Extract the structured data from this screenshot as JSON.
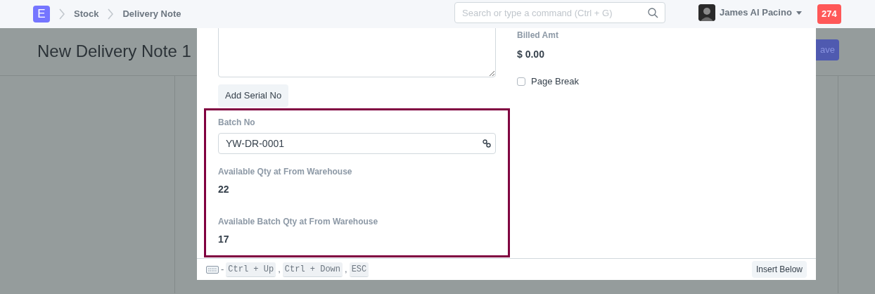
{
  "navbar": {
    "logo": "E",
    "breadcrumbs": [
      "Stock",
      "Delivery Note"
    ],
    "search": {
      "placeholder": "Search or type a command (Ctrl + G)"
    },
    "user": {
      "name": "James Al Pacino"
    },
    "notifications": "274"
  },
  "page": {
    "title": "New Delivery Note 1",
    "save_button": "ave"
  },
  "dialog": {
    "add_serial_button": "Add Serial No",
    "batch": {
      "label": "Batch No",
      "value": "YW-DR-0001"
    },
    "fields": [
      {
        "label": "Available Qty at From Warehouse",
        "value": "22"
      },
      {
        "label": "Available Batch Qty at From Warehouse",
        "value": "17"
      }
    ],
    "billed": {
      "label": "Billed Amt",
      "value": "$ 0.00"
    },
    "page_break": {
      "label": "Page Break",
      "checked": false
    },
    "shortcut_dash": "-",
    "shortcut_separator": ",",
    "shortcuts": [
      "Ctrl + Up",
      "Ctrl + Down",
      "ESC"
    ],
    "insert_button": "Insert Below"
  }
}
